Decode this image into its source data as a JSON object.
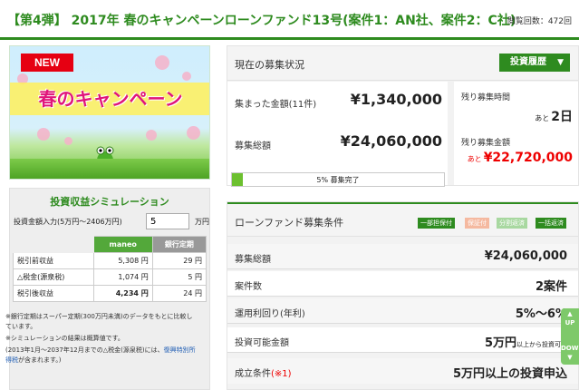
{
  "header": {
    "title": "【第4弾】 2017年 春のキャンペーンローンファンド13号(案件1：AN社、案件2：C社)",
    "views": "閲覧回数：472回"
  },
  "banner": {
    "new_tag": "NEW",
    "title": "春のキャンペーン"
  },
  "simulation": {
    "title": "投資収益シミュレーション",
    "input_label": "投資金額入力(5万円〜2406万円)",
    "input_value": "5",
    "input_unit": "万円",
    "columns": [
      "",
      "maneo",
      "銀行定期"
    ],
    "rows": [
      {
        "label": "税引前収益",
        "maneo": "5,308 円",
        "bank": "29 円"
      },
      {
        "label": "△税金(源泉税)",
        "maneo": "1,074 円",
        "bank": "5 円"
      },
      {
        "label": "税引後収益",
        "maneo": "4,234 円",
        "bank": "24 円"
      }
    ],
    "note1": "※銀行定期はスーパー定期(300万円未満)のデータをもとに比較しています。",
    "note2": "※シミュレーションの結果は概算値です。",
    "note3_pre": "(2013年1月〜2037年12月までの△税金(源泉税)には、",
    "note3_link": "復興特別所得税",
    "note3_post": "が含まれます。)"
  },
  "status": {
    "heading": "現在の募集状況",
    "history_button": "投資履歴",
    "raised_label": "集まった金額(11件)",
    "raised_value": "¥1,340,000",
    "target_label": "募集総額",
    "target_value": "¥24,060,000",
    "progress_percent": 5,
    "progress_text": "5% 募集完了",
    "remaining_time_label": "残り募集時間",
    "remaining_time_prefix": "あと",
    "remaining_time_value": "2日",
    "remaining_amount_label": "残り募集金額",
    "remaining_amount_prefix": "あと",
    "remaining_amount_value": "¥22,720,000"
  },
  "conditions": {
    "heading": "ローンファンド募集条件",
    "badges": [
      {
        "label": "一部担保付",
        "color": "#2e8b1f"
      },
      {
        "label": "保証付",
        "color": "#f5b9a0"
      },
      {
        "label": "分割返済",
        "color": "#a8d8a0"
      },
      {
        "label": "一括返済",
        "color": "#2e8b1f"
      }
    ],
    "rows": [
      {
        "key": "募集総額",
        "value": "¥24,060,000",
        "suffix": ""
      },
      {
        "key": "案件数",
        "value": "2案件",
        "suffix": ""
      },
      {
        "key": "運用利回り(年利)",
        "value": "5%〜6%",
        "suffix": ""
      },
      {
        "key": "投資可能金額",
        "value": "5万円",
        "suffix": "以上から投資可能"
      },
      {
        "key": "成立条件",
        "key_note": "(※1)",
        "value": "5万円以上の投資申込",
        "suffix": ""
      }
    ]
  },
  "scroll_widget": {
    "up": "UP",
    "down": "DOWN"
  },
  "colors": {
    "brand_green": "#2e8b1f",
    "accent_red": "#e00000"
  }
}
